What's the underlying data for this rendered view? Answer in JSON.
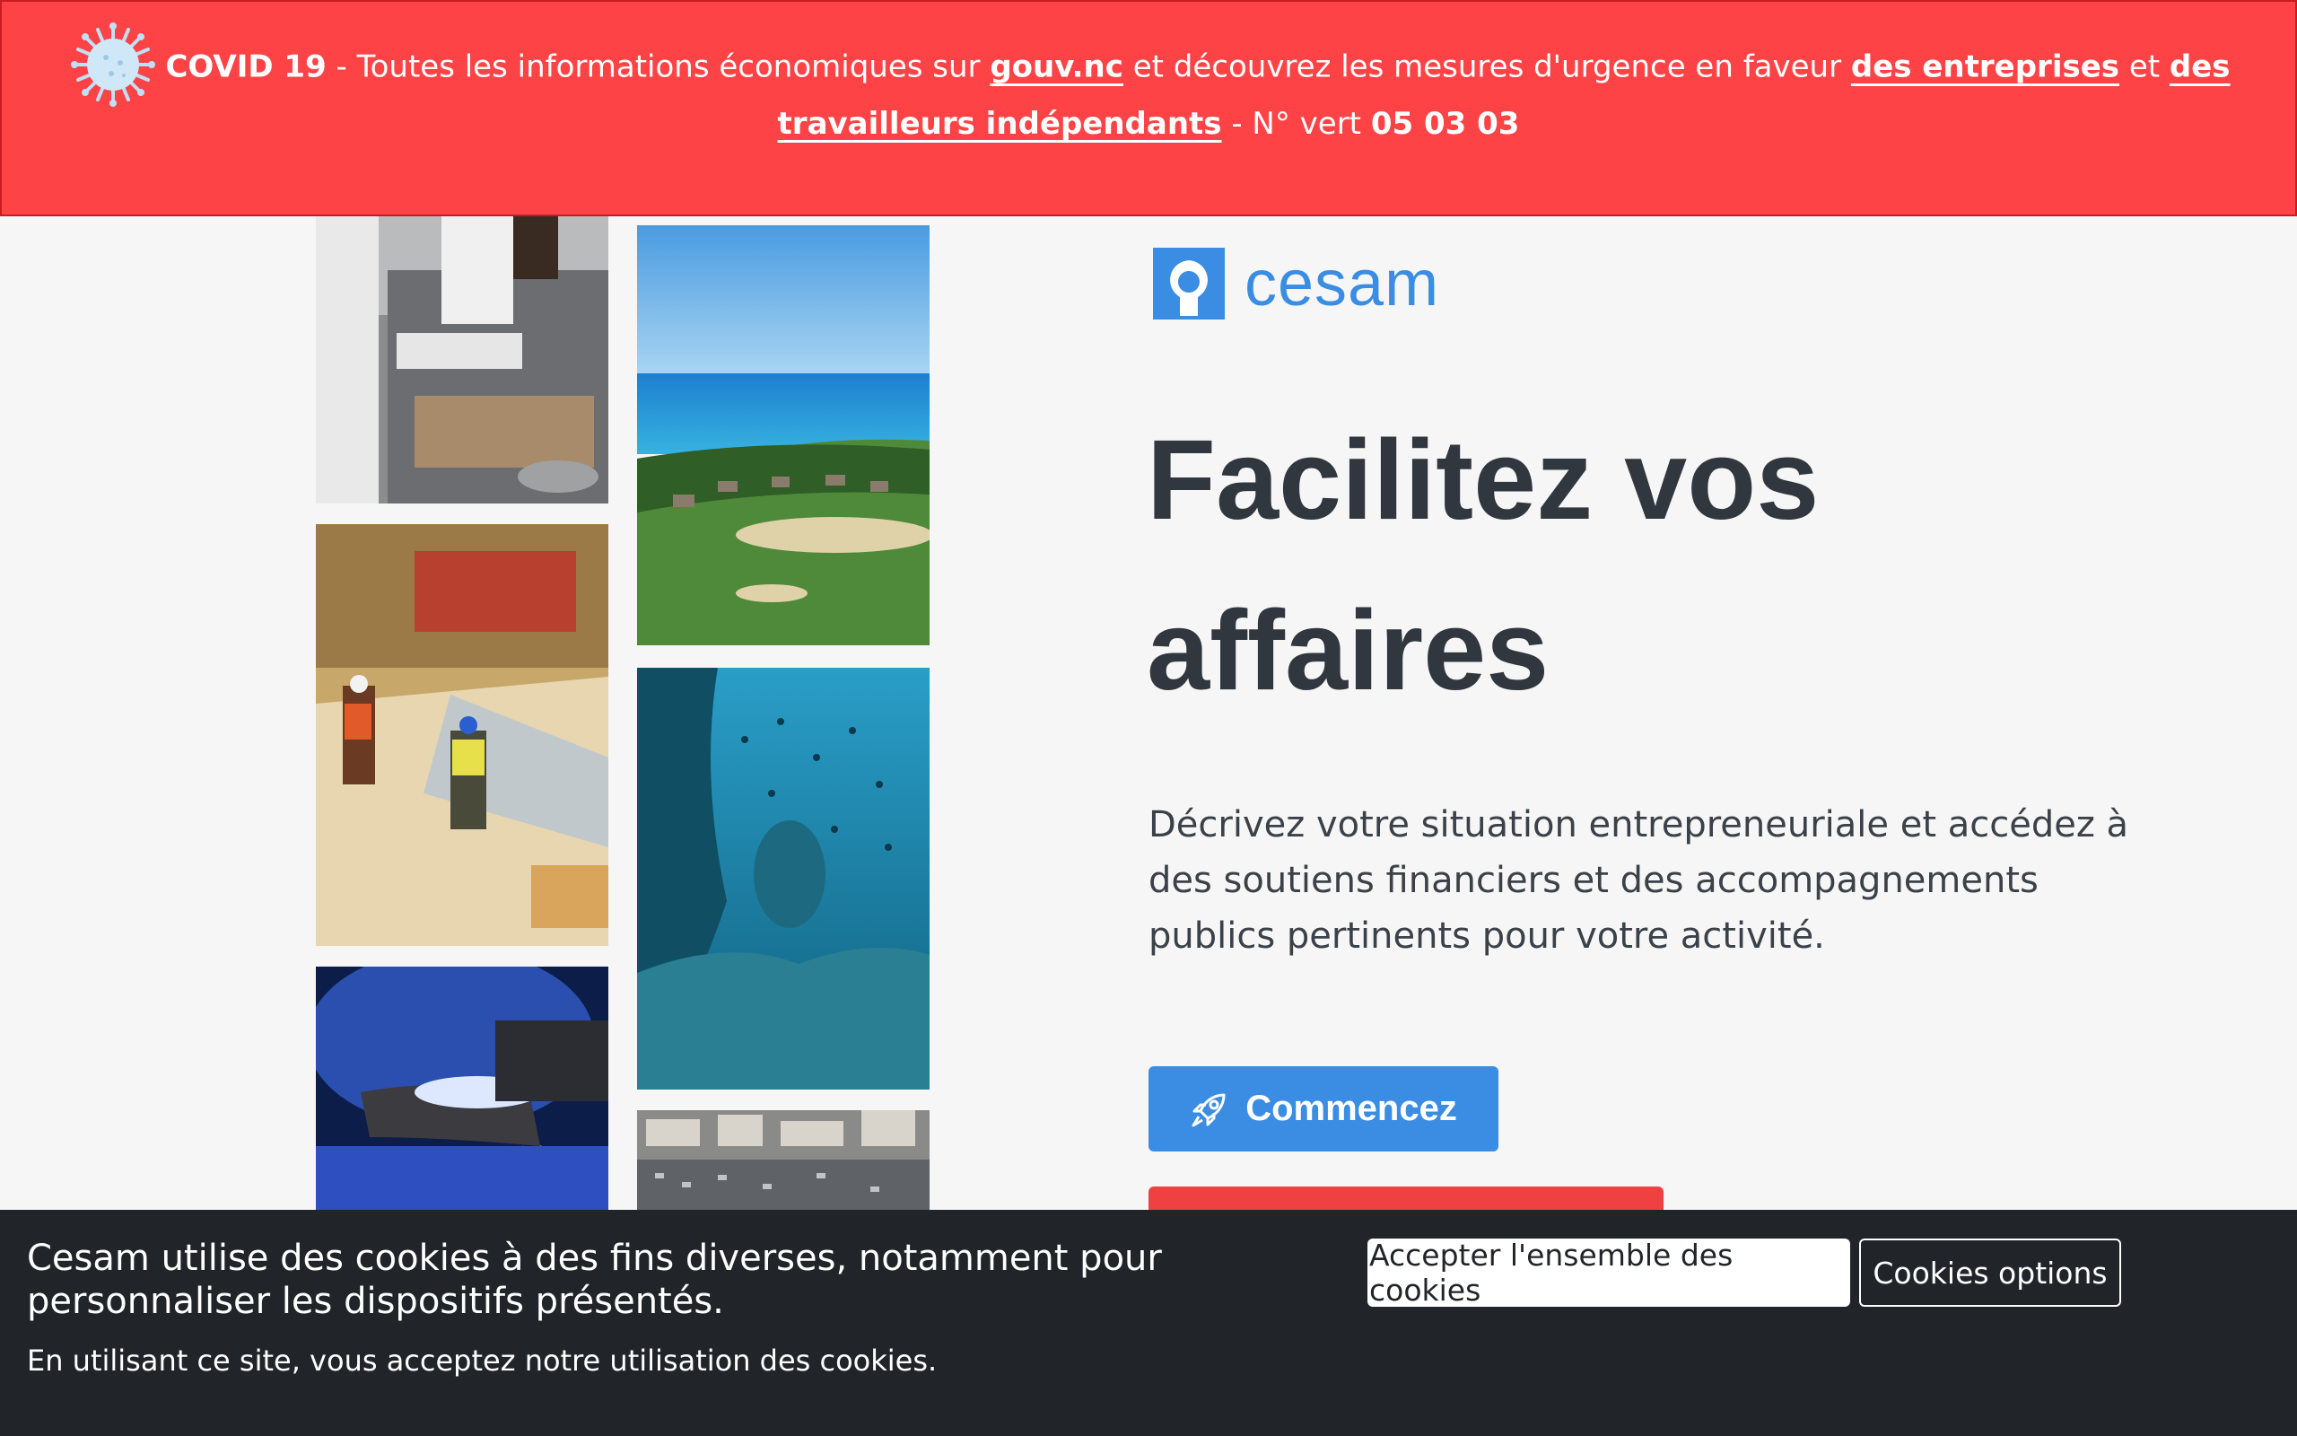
{
  "covid_banner": {
    "label": "COVID 19",
    "text_1": " - Toutes les informations économiques sur ",
    "link_gouv": "gouv.nc",
    "text_2": " et découvrez les mesures d'urgence en faveur ",
    "link_entreprises": "des entreprises",
    "text_3": " et ",
    "link_travailleurs_1": "des",
    "link_travailleurs_2": "travailleurs indépendants",
    "text_4": " - N° vert ",
    "phone": "05 03 03",
    "icon": "virus-icon"
  },
  "header": {
    "logo_text": "cesam",
    "logo_icon": "cesam-logo-icon"
  },
  "hero": {
    "title_line1": "Facilitez vos",
    "title_line2": "affaires",
    "description": "Décrivez votre situation entrepreneuriale et accédez à des soutiens financiers et des accompagnements publics pertinents pour votre activité.",
    "start_button": "Commencez",
    "start_icon": "rocket-icon"
  },
  "photos": [
    "kitchen-photo",
    "coast-golf-photo",
    "construction-photo",
    "underwater-photo",
    "welding-photo",
    "city-photo"
  ],
  "cookie_bar": {
    "title": "Cesam utilise des cookies à des fins diverses, notamment pour personnaliser les dispositifs présentés.",
    "subtitle": "En utilisant ce site, vous acceptez notre utilisation des cookies.",
    "accept_label": "Accepter l'ensemble des cookies",
    "options_label": "Cookies options"
  },
  "colors": {
    "banner_red": "#fd4346",
    "brand_blue": "#3a8de2",
    "title_dark": "#31373f",
    "cookie_bg": "#212529"
  }
}
